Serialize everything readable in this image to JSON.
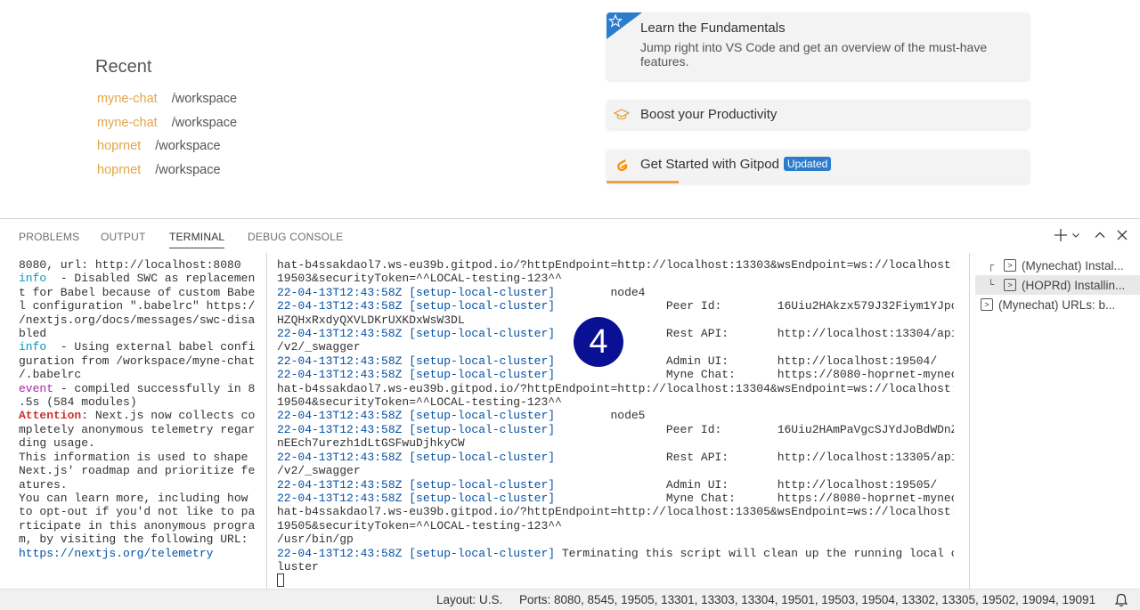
{
  "welcome": {
    "recent": {
      "title": "Recent",
      "items": [
        {
          "name": "myne-chat",
          "path": "/workspace"
        },
        {
          "name": "myne-chat",
          "path": "/workspace"
        },
        {
          "name": "hoprnet",
          "path": "/workspace"
        },
        {
          "name": "hoprnet",
          "path": "/workspace"
        }
      ]
    },
    "cards": {
      "fundamentals": {
        "title": "Learn the Fundamentals",
        "description": "Jump right into VS Code and get an overview of the must-have features.",
        "icon": "star-icon"
      },
      "productivity": {
        "title": "Boost your Productivity",
        "icon": "mortarboard-icon"
      },
      "gitpod": {
        "title": "Get Started with Gitpod",
        "badge": "Updated",
        "icon": "gitpod-logo-icon",
        "progress": 0.17
      }
    }
  },
  "panel": {
    "tabs": [
      {
        "label": "PROBLEMS"
      },
      {
        "label": "OUTPUT"
      },
      {
        "label": "TERMINAL",
        "active": true
      },
      {
        "label": "DEBUG CONSOLE"
      }
    ],
    "actions": [
      "plus-icon",
      "chevron-down-icon",
      "chevron-up-icon",
      "close-icon"
    ],
    "terminals": [
      {
        "label": "(Mynechat) Instal...",
        "tree": "┌"
      },
      {
        "label": "(HOPRd) Installin...",
        "tree": "└",
        "selected": true
      },
      {
        "label": "(Mynechat) URLs: b...",
        "tree": ""
      }
    ]
  },
  "step_marker": "4",
  "statusbar": {
    "layout": "Layout: U.S.",
    "ports": "Ports: 8080, 8545, 19505, 13301, 13303, 13304, 19501, 19503, 19504, 13302, 13305, 19502, 19094, 19091",
    "bell_icon": "bell-icon"
  },
  "colors": {
    "accent_orange": "#e4a547",
    "badge_blue": "#2b7ccd",
    "marker_navy": "#0a1094"
  }
}
